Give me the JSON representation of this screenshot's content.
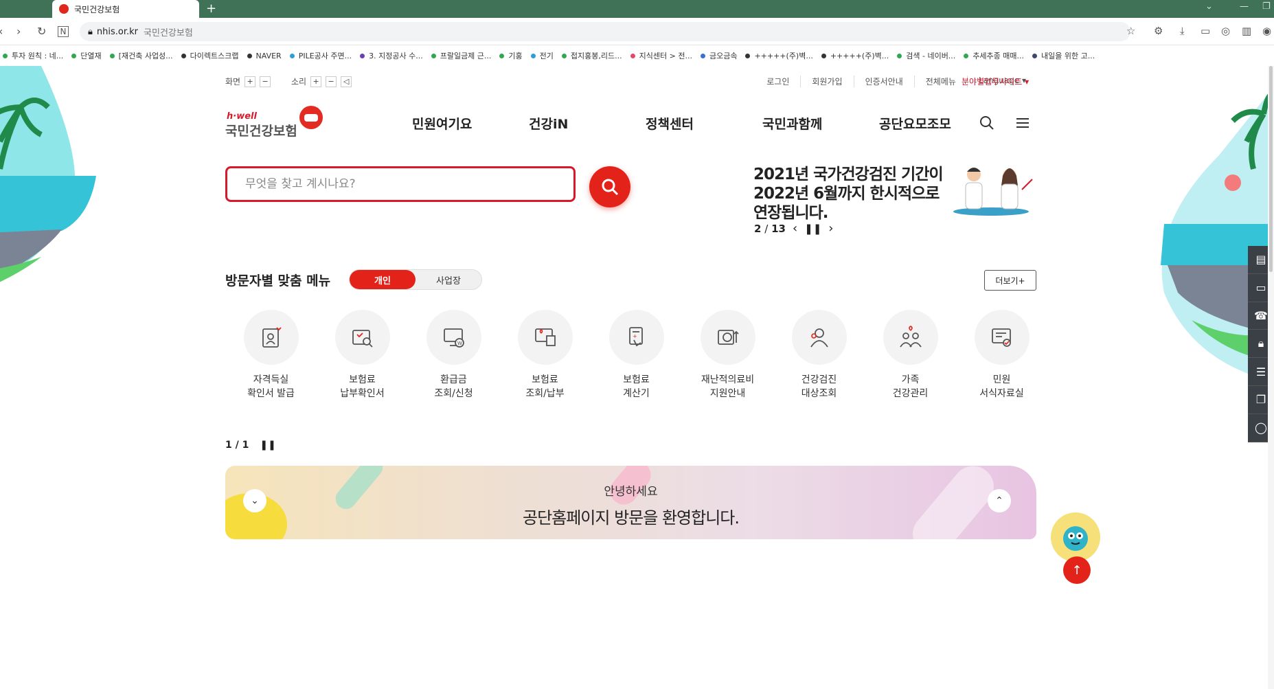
{
  "browser": {
    "tab_title": "국민건강보험",
    "new_tab": "+",
    "url_host": "nhis.or.kr",
    "url_page": "국민건강보험",
    "bookmarks": [
      {
        "label": "투자 원칙 : 네...",
        "color": "#2fa84f"
      },
      {
        "label": "단열재",
        "color": "#2fa84f"
      },
      {
        "label": "[재건축 사업성...",
        "color": "#2fa84f"
      },
      {
        "label": "다이렉트스크랩",
        "color": "#333333"
      },
      {
        "label": "NAVER",
        "color": "#333333"
      },
      {
        "label": "PILE공사 주면...",
        "color": "#2d9fd8"
      },
      {
        "label": "3. 지정공사 수...",
        "color": "#6a3fb5"
      },
      {
        "label": "프랄일금제 근...",
        "color": "#2fa84f"
      },
      {
        "label": "기홍",
        "color": "#2fa84f"
      },
      {
        "label": "전기",
        "color": "#2d9fd8"
      },
      {
        "label": "접지홍봉,리드...",
        "color": "#2fa84f"
      },
      {
        "label": "지식센터 > 전...",
        "color": "#e24a6a"
      },
      {
        "label": "금오금속",
        "color": "#3c6fd6"
      },
      {
        "label": "+++++(주)벽...",
        "color": "#333333"
      },
      {
        "label": "+++++(주)벽...",
        "color": "#333333"
      },
      {
        "label": "검색 - 네이버...",
        "color": "#2fa84f"
      },
      {
        "label": "추세추종 매매...",
        "color": "#2fa84f"
      },
      {
        "label": "내일을 위한 고...",
        "color": "#3b4a6b"
      }
    ]
  },
  "util": {
    "screen_label": "화면",
    "sound_label": "소리",
    "plus": "+",
    "minus": "−",
    "links": [
      "로그인",
      "회원가입",
      "인증서안내",
      "전체메뉴"
    ],
    "language": "Language ▾",
    "business_site": "분야별업무사이트 ▾"
  },
  "logo": {
    "small": "h·well",
    "big": "국민건강보험"
  },
  "gnb": [
    "민원여기요",
    "건강iN",
    "정책센터",
    "국민과함께",
    "공단요모조모"
  ],
  "search": {
    "placeholder": "무엇을 찾고 계시나요?"
  },
  "notice": {
    "line1": "2021년 국가건강검진 기간이",
    "line2": "2022년 6월까지 한시적으로",
    "line3": "연장됩니다.",
    "current": "2",
    "sep": "/",
    "total": "13"
  },
  "visitor_menu": {
    "title": "방문자별 맞춤 메뉴",
    "tab_personal": "개인",
    "tab_business": "사업장",
    "more": "더보기+",
    "items": [
      {
        "line1": "자격득실",
        "line2": "확인서 발급"
      },
      {
        "line1": "보험료",
        "line2": "납부확인서"
      },
      {
        "line1": "환급금",
        "line2": "조회/신청"
      },
      {
        "line1": "보험료",
        "line2": "조회/납부"
      },
      {
        "line1": "보험료",
        "line2": "계산기"
      },
      {
        "line1": "재난적의료비",
        "line2": "지원안내"
      },
      {
        "line1": "건강검진",
        "line2": "대상조회"
      },
      {
        "line1": "가족",
        "line2": "건강관리"
      },
      {
        "line1": "민원",
        "line2": "서식자료실"
      }
    ],
    "pager": "1 / 1"
  },
  "welcome": {
    "line1": "안녕하세요",
    "line2": "공단홈페이지 방문을 환영합니다."
  },
  "colors": {
    "brand_red": "#e3231a",
    "chrome_green": "#3f7256",
    "dock": "#3b3f46"
  }
}
